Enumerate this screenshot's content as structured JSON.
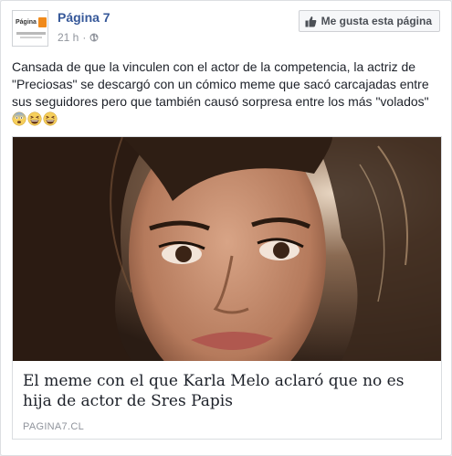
{
  "post": {
    "page_name": "Página 7",
    "time": "21 h",
    "separator": "·",
    "like_button_label": "Me gusta esta página",
    "text": "Cansada de que la vinculen con el actor de la competencia, la actriz de \"Preciosas\" se descargó con un cómico meme que sacó carcajadas entre sus seguidores pero que también causó sorpresa entre los más \"volados\"",
    "emojis": [
      "fearful-face-emoji",
      "grinning-squinting-face-emoji",
      "grinning-squinting-face-emoji"
    ]
  },
  "avatar": {
    "logo_text": "Página"
  },
  "link": {
    "title": "El meme con el que Karla Melo aclaró que no es hija de actor de Sres Papis",
    "domain": "PAGINA7.CL"
  },
  "colors": {
    "page_name": "#365899",
    "meta": "#90949c",
    "text": "#1d2129",
    "logo_accent": "#f08a1c"
  }
}
